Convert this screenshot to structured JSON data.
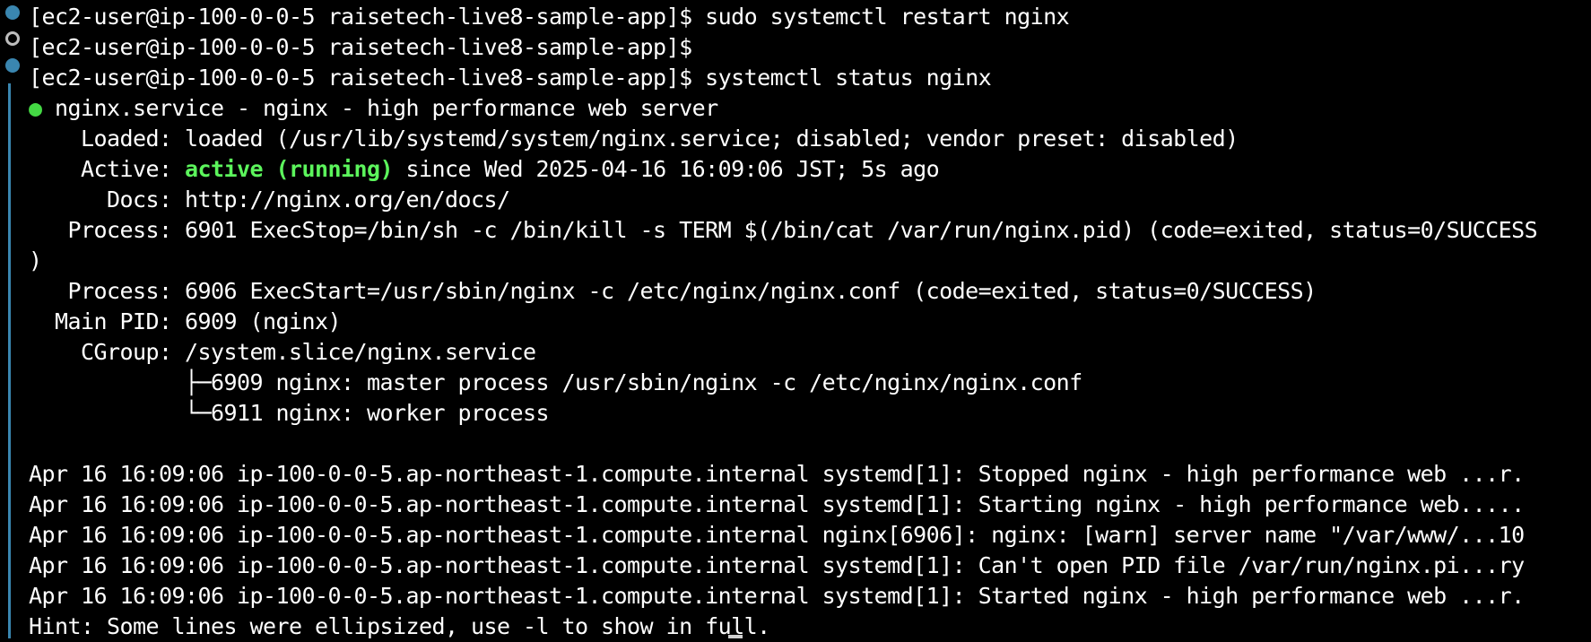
{
  "terminal": {
    "prompt": "[ec2-user@ip-100-0-0-5 raisetech-live8-sample-app]$",
    "commands": {
      "restart": " sudo systemctl restart nginx",
      "empty": "",
      "status": " systemctl status nginx"
    },
    "status": {
      "bullet": "●",
      "title": " nginx.service - nginx - high performance web server",
      "loaded": "    Loaded: loaded (/usr/lib/systemd/system/nginx.service; disabled; vendor preset: disabled)",
      "active_label": "    Active: ",
      "active_state": "active (running)",
      "active_rest": " since Wed 2025-04-16 16:09:06 JST; 5s ago",
      "docs": "      Docs: http://nginx.org/en/docs/",
      "process_stop": "   Process: 6901 ExecStop=/bin/sh -c /bin/kill -s TERM $(/bin/cat /var/run/nginx.pid) (code=exited, status=0/SUCCESS",
      "process_stop_wrap": ")",
      "process_start": "   Process: 6906 ExecStart=/usr/sbin/nginx -c /etc/nginx/nginx.conf (code=exited, status=0/SUCCESS)",
      "main_pid": "  Main PID: 6909 (nginx)",
      "cgroup": "    CGroup: /system.slice/nginx.service",
      "cgroup_master": "            ├─6909 nginx: master process /usr/sbin/nginx -c /etc/nginx/nginx.conf",
      "cgroup_worker": "            └─6911 nginx: worker process"
    },
    "logs": [
      "Apr 16 16:09:06 ip-100-0-0-5.ap-northeast-1.compute.internal systemd[1]: Stopped nginx - high performance web ...r.",
      "Apr 16 16:09:06 ip-100-0-0-5.ap-northeast-1.compute.internal systemd[1]: Starting nginx - high performance web.....",
      "Apr 16 16:09:06 ip-100-0-0-5.ap-northeast-1.compute.internal nginx[6906]: nginx: [warn] server name \"/var/www/...10",
      "Apr 16 16:09:06 ip-100-0-0-5.ap-northeast-1.compute.internal systemd[1]: Can't open PID file /var/run/nginx.pi...ry",
      "Apr 16 16:09:06 ip-100-0-0-5.ap-northeast-1.compute.internal systemd[1]: Started nginx - high performance web ...r."
    ],
    "hint": "Hint: Some lines were ellipsized, use -l to show in full."
  },
  "colors": {
    "background": "#000000",
    "text": "#ffffff",
    "active_green": "#5cf55c",
    "marker_blue": "#3a86b0"
  }
}
